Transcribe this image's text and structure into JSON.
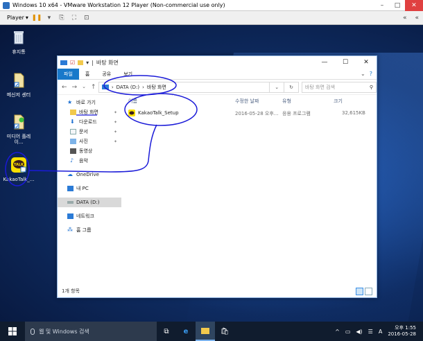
{
  "vmware": {
    "title": "Windows 10 x64 - VMware Workstation 12 Player (Non-commercial use only)",
    "player_label": "Player",
    "controls": {
      "minimize": "–",
      "maximize": "□",
      "close": "✕"
    },
    "right_controls": [
      "«",
      "«"
    ]
  },
  "desktop_icons": [
    {
      "label": "휴지통"
    },
    {
      "label": "메신저 센터"
    },
    {
      "label": "미디어 플레이..."
    },
    {
      "label": "KakaoTalk_..."
    }
  ],
  "explorer": {
    "title": "바탕 화면",
    "tabs": [
      "파일",
      "홈",
      "공유",
      "보기"
    ],
    "address": {
      "crumbs": [
        "DATA (D:)",
        "바탕 화면"
      ],
      "separator": "›",
      "refresh": "↻"
    },
    "search": {
      "placeholder": "바탕 화면 검색",
      "icon": "search-icon"
    },
    "nav": [
      {
        "label": "바로 가기",
        "icon": "star-icon",
        "pinned": false
      },
      {
        "label": "바탕 화면",
        "icon": "folder-icon",
        "pinned": true
      },
      {
        "label": "다운로드",
        "icon": "download-icon",
        "pinned": true
      },
      {
        "label": "문서",
        "icon": "document-icon",
        "pinned": true
      },
      {
        "label": "사진",
        "icon": "picture-icon",
        "pinned": true
      },
      {
        "label": "동영상",
        "icon": "video-icon",
        "pinned": false
      },
      {
        "label": "음악",
        "icon": "music-icon",
        "pinned": false
      },
      {
        "label": "OneDrive",
        "icon": "cloud-icon",
        "pinned": false
      },
      {
        "label": "내 PC",
        "icon": "pc-icon",
        "pinned": false
      },
      {
        "label": "DATA (D:)",
        "icon": "drive-icon",
        "pinned": false
      },
      {
        "label": "네트워크",
        "icon": "network-icon",
        "pinned": false
      },
      {
        "label": "홈 그룹",
        "icon": "homegroup-icon",
        "pinned": false
      }
    ],
    "columns": [
      "이름",
      "수정한 날짜",
      "유형",
      "크기"
    ],
    "files": [
      {
        "name": "KakaoTalk_Setup",
        "modified": "2016-05-28 오후...",
        "type": "응용 프로그램",
        "size": "32,615KB"
      }
    ],
    "status": "1개 항목",
    "sort_arrow": "^"
  },
  "taskbar": {
    "search_placeholder": "웹 및 Windows 검색",
    "ime": "A",
    "time": "오후 1:55",
    "date": "2016-05-28"
  },
  "colors": {
    "accent": "#1979ca",
    "annotation": "#1a1ad8",
    "kakao": "#f9e000"
  }
}
